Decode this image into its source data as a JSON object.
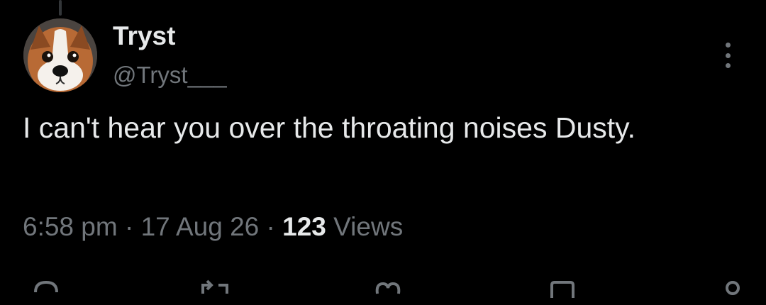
{
  "tweet": {
    "author": {
      "display_name": "Tryst",
      "handle": "@Tryst___",
      "avatar_icon": "dog-avatar"
    },
    "text": "I can't hear you over the throating noises Dusty.",
    "time": "6:58 pm",
    "separator": "·",
    "date": "17 Aug 26",
    "views_count": "123",
    "views_label": "Views"
  },
  "icons": {
    "more": "more-vertical-icon",
    "reply": "reply-icon",
    "retweet": "retweet-icon",
    "like": "heart-icon",
    "bookmark": "bookmark-icon",
    "share": "share-icon"
  },
  "colors": {
    "background": "#000000",
    "primary_text": "#e7e9ea",
    "secondary_text": "#71767b",
    "thread_line": "#333639"
  }
}
